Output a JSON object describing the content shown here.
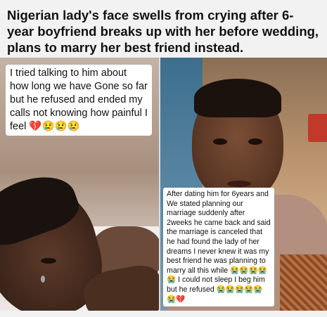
{
  "headline": "Nigerian lady's face swells from crying after 6-year boyfriend breaks up with her before wedding, plans to marry her best friend instead.",
  "left_caption": "I tried talking to him about how long we have Gone so far but he refused and ended my calls not knowing how painful I feel 💔😢😢😢",
  "right_caption": "After dating him for 6years and We stated planning our marriage suddenly after 2weeks he came back and said the marriage is canceled that he had found the lady of her dreams I never knew it was my best friend he was planning to marry all this while 😭😭😭😭😭 I could not sleep I beg him but he refused 😭😭😭😭😭😭💔"
}
